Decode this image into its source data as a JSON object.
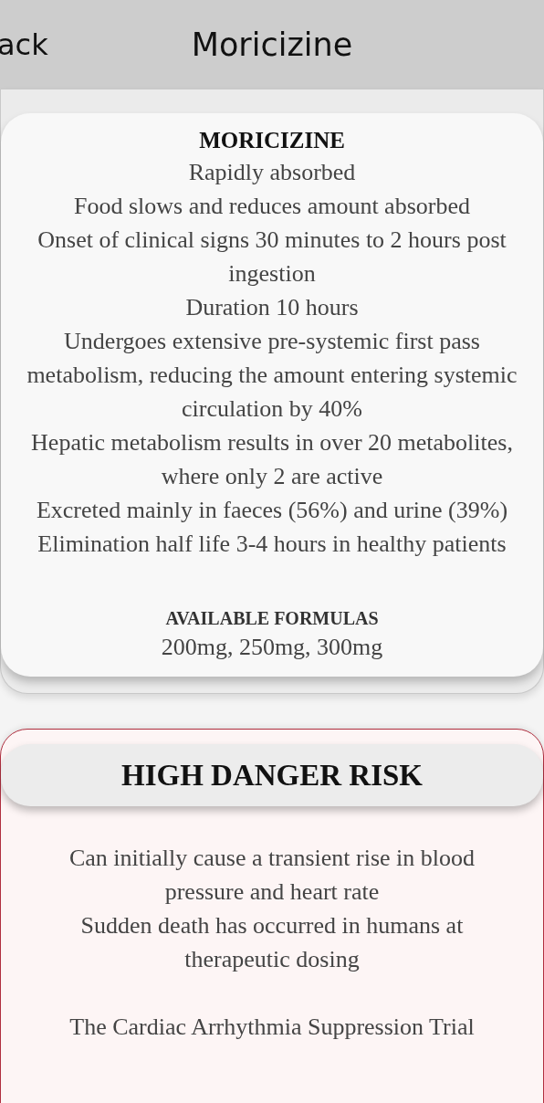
{
  "header": {
    "back_label": "ack",
    "title": "Moricizine"
  },
  "drug_card": {
    "title": "MORICIZINE",
    "lines": [
      "Rapidly absorbed",
      "Food slows and reduces amount absorbed",
      "Onset of clinical signs 30 minutes to 2 hours post ingestion",
      "Duration 10 hours",
      "Undergoes extensive pre-systemic first pass metabolism, reducing the amount entering systemic circulation by 40%",
      "Hepatic metabolism results in over 20 metabolites, where only 2 are active",
      "Excreted mainly in faeces (56%) and urine (39%)",
      "Elimination half life 3-4 hours in healthy patients"
    ],
    "formulas_heading": "AVAILABLE FORMULAS",
    "formulas": "200mg, 250mg, 300mg"
  },
  "danger_card": {
    "heading": "HIGH DANGER RISK",
    "paragraphs": [
      [
        "Can initially cause a transient rise in blood pressure and heart rate",
        "Sudden death has occurred in humans at therapeutic dosing"
      ],
      [
        "The Cardiac Arrhythmia Suppression Trial"
      ]
    ]
  }
}
